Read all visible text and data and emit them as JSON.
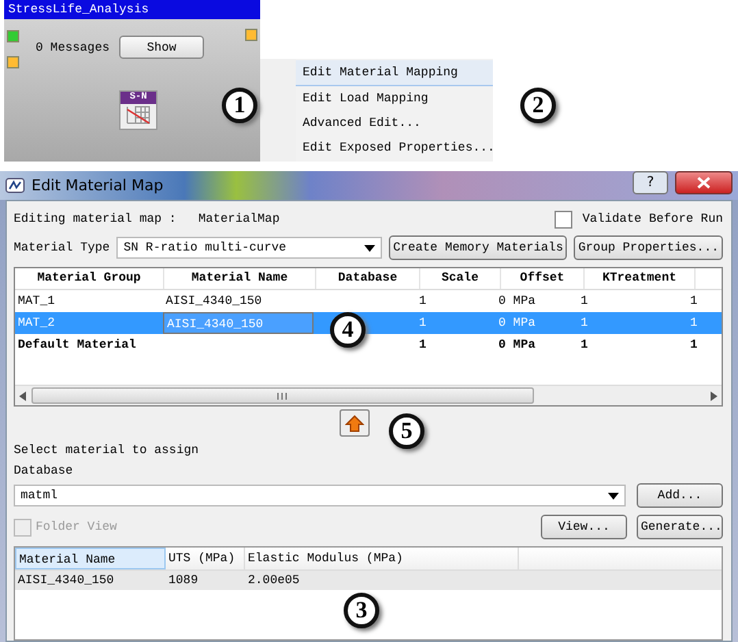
{
  "node": {
    "title": "StressLife_Analysis",
    "messages": "0 Messages",
    "show_button": "Show",
    "icon_label": "S-N"
  },
  "context_menu": [
    {
      "label": "Edit Material Mapping",
      "selected": true
    },
    {
      "label": "Edit Load Mapping",
      "selected": false
    },
    {
      "label": "Advanced Edit...",
      "selected": false
    },
    {
      "label": "Edit Exposed Properties...",
      "selected": false
    }
  ],
  "callouts": [
    "1",
    "2",
    "4",
    "5",
    "3"
  ],
  "dialog": {
    "title": "Edit Material Map",
    "help_button": "?",
    "editing_label": "Editing material map :",
    "editing_value": "MaterialMap",
    "validate": {
      "label": "Validate Before Run",
      "checked": false
    },
    "material_type_label": "Material Type",
    "material_type": "SN R-ratio multi-curve",
    "buttons": [
      "Create Memory Materials",
      "Group Properties..."
    ],
    "table": {
      "columns": [
        "Material Group",
        "Material Name",
        "Database",
        "Scale",
        "Offset",
        "KTreatment"
      ],
      "rows": [
        {
          "cells": [
            "MAT_1",
            "AISI_4340_150",
            null,
            "1",
            "0 MPa",
            "1",
            "1"
          ],
          "selected": false,
          "bold": false
        },
        {
          "cells": [
            "MAT_2",
            "AISI_4340_150",
            null,
            "1",
            "0 MPa",
            "1",
            "1"
          ],
          "selected": true,
          "bold": false
        },
        {
          "cells": [
            "Default Material",
            null,
            null,
            "1",
            "0 MPa",
            "1",
            "1"
          ],
          "selected": false,
          "bold": true
        }
      ]
    },
    "select_label": "Select material to assign",
    "database_label": "Database",
    "database": "matml",
    "add_button": "Add...",
    "folder_view": {
      "label": "Folder View",
      "checked": false,
      "disabled": true
    },
    "view_button": "View...",
    "generate_button": "Generate...",
    "materials": {
      "columns": [
        "Material Name",
        "UTS (MPa)",
        "Elastic Modulus (MPa)"
      ],
      "rows": [
        [
          "AISI_4340_150",
          "1089",
          "2.00e05"
        ]
      ]
    }
  }
}
